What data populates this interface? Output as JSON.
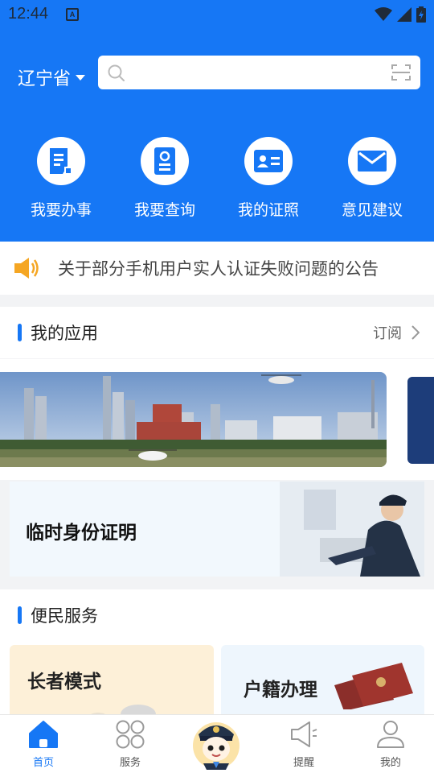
{
  "status_bar": {
    "time": "12:44",
    "badge": "A"
  },
  "header": {
    "region": "辽宁省",
    "search": {
      "placeholder": ""
    }
  },
  "quick_actions": [
    {
      "label": "我要办事",
      "icon": "document-icon"
    },
    {
      "label": "我要查询",
      "icon": "search-document-icon"
    },
    {
      "label": "我的证照",
      "icon": "id-card-icon"
    },
    {
      "label": "意见建议",
      "icon": "mail-icon"
    }
  ],
  "notice": {
    "text": "关于部分手机用户实人认证失败问题的公告",
    "icon": "speaker-icon"
  },
  "my_apps": {
    "title": "我的应用",
    "more": "订阅"
  },
  "id_card": {
    "label": "临时身份证明"
  },
  "convenience": {
    "title": "便民服务",
    "items": [
      {
        "label": "长者模式"
      },
      {
        "label": "户籍办理"
      }
    ]
  },
  "bottom_nav": [
    {
      "label": "首页",
      "icon": "home-icon",
      "active": true
    },
    {
      "label": "服务",
      "icon": "grid-icon",
      "active": false
    },
    {
      "label": "提醒",
      "icon": "megaphone-icon",
      "active": false
    },
    {
      "label": "我的",
      "icon": "user-icon",
      "active": false
    }
  ],
  "colors": {
    "primary": "#1677f5",
    "notice_icon": "#f5a623"
  }
}
